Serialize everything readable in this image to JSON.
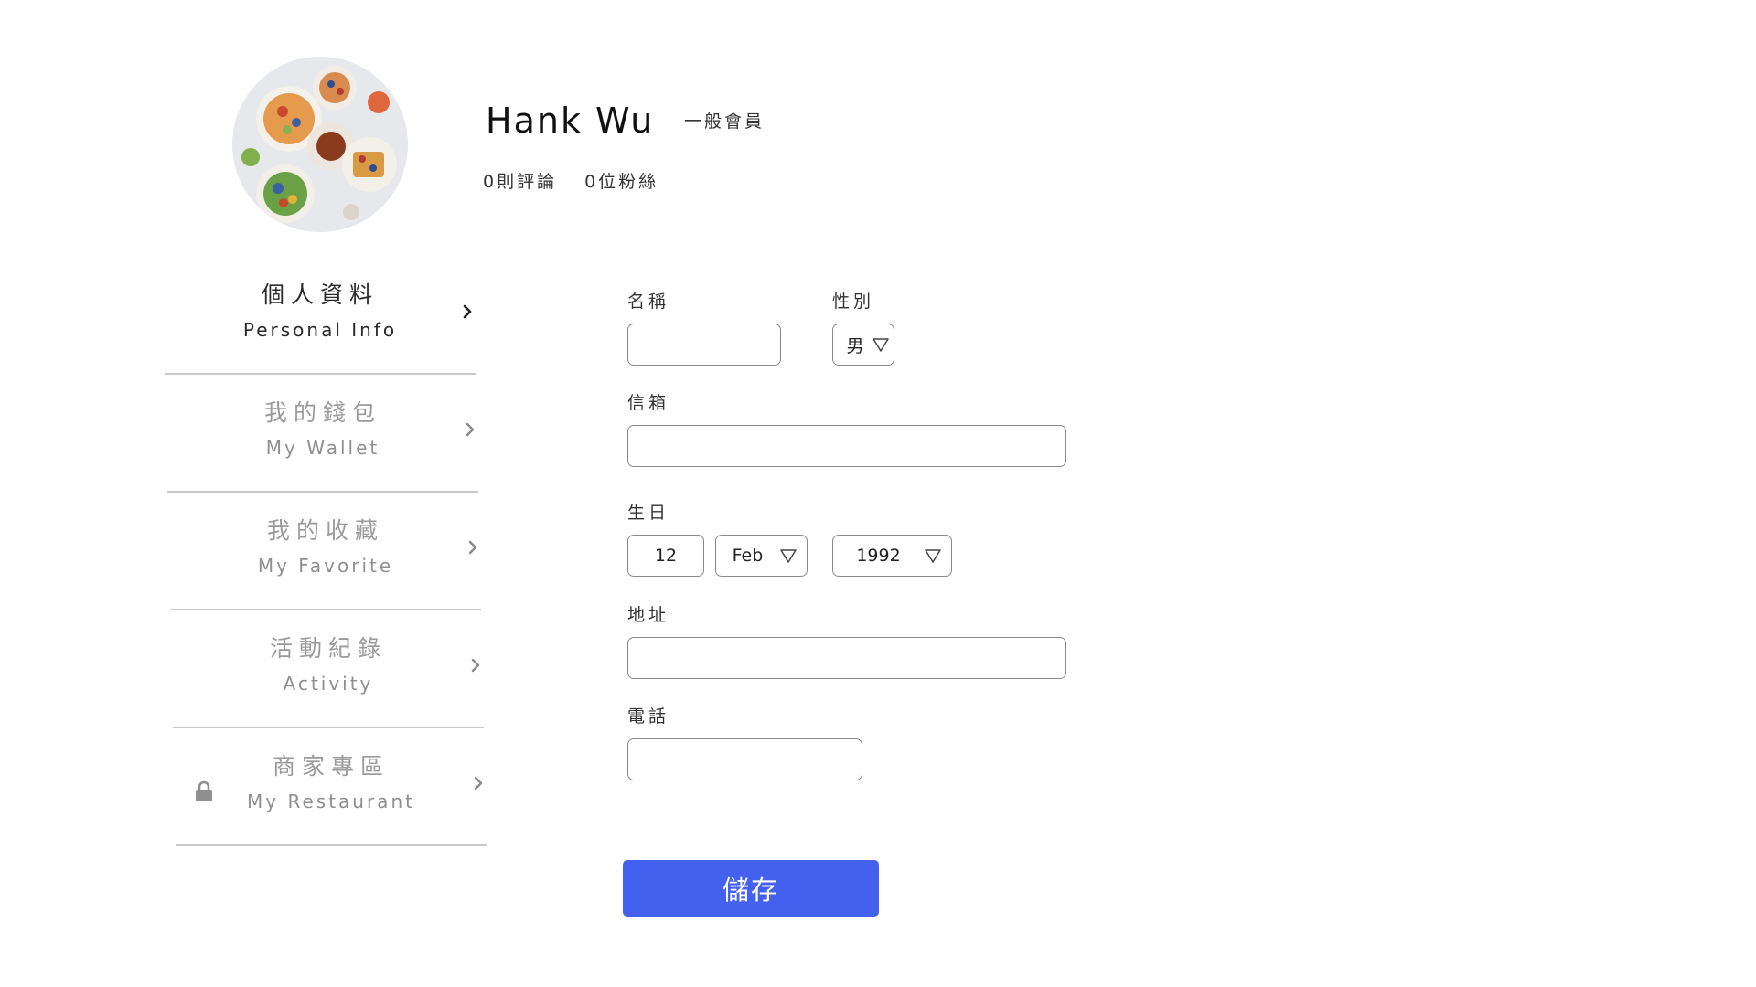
{
  "profile": {
    "name": "Hank Wu",
    "member_level": "一般會員",
    "reviews": "0則評論",
    "followers": "0位粉絲"
  },
  "menu": {
    "items": [
      {
        "zh": "個人資料",
        "en": "Personal Info",
        "active": true,
        "icon": "chevron-right-icon"
      },
      {
        "zh": "我的錢包",
        "en": "My Wallet",
        "active": false,
        "icon": "chevron-right-icon"
      },
      {
        "zh": "我的收藏",
        "en": "My Favorite",
        "active": false,
        "icon": "chevron-right-icon"
      },
      {
        "zh": "活動紀錄",
        "en": "Activity",
        "active": false,
        "icon": "chevron-right-icon"
      },
      {
        "zh": "商家專區",
        "en": "My Restaurant",
        "active": false,
        "icon": "chevron-right-icon",
        "locked": true,
        "lock_icon": "lock-icon"
      }
    ]
  },
  "form": {
    "name_label": "名稱",
    "name_value": "",
    "gender_label": "性別",
    "gender_value": "男",
    "email_label": "信箱",
    "email_value": "",
    "birthday_label": "生日",
    "birthday_day": "12",
    "birthday_month": "Feb",
    "birthday_year": "1992",
    "address_label": "地址",
    "address_value": "",
    "phone_label": "電話",
    "phone_value": "",
    "save_label": "儲存",
    "dropdown_icon": "triangle-down-icon"
  },
  "colors": {
    "accent": "#4361ee",
    "active_text": "#2a2a2a",
    "inactive_text": "#9a9a9a",
    "divider": "#c9c9c9",
    "field_border": "#8a8a8a"
  }
}
